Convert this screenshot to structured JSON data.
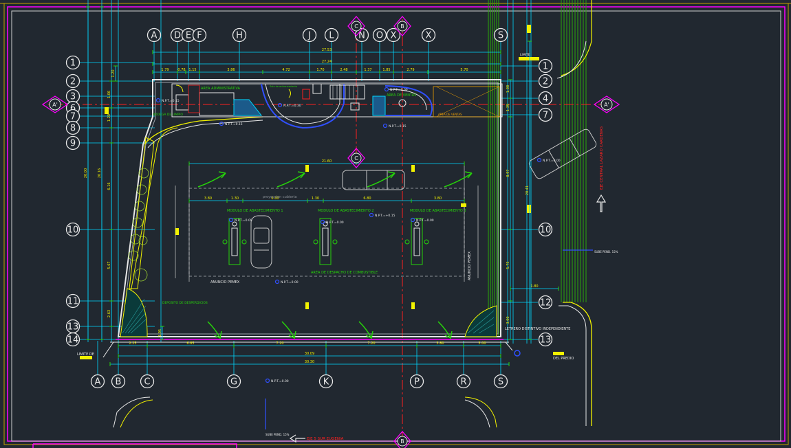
{
  "grid_top": [
    "A",
    "D",
    "E",
    "F",
    "H",
    "J",
    "L",
    "N",
    "O",
    "X",
    "X",
    "S"
  ],
  "grid_bottom": [
    "A",
    "B",
    "C",
    "G",
    "K",
    "P",
    "R",
    "S"
  ],
  "rows_left": [
    "1",
    "2",
    "3",
    "6",
    "7",
    "8",
    "9",
    "10",
    "11",
    "13",
    "14"
  ],
  "rows_right": [
    "1",
    "2",
    "4",
    "7",
    "10",
    "12",
    "13"
  ],
  "section_labels": {
    "a": "A'",
    "c": "C",
    "b": "B"
  },
  "labels": {
    "area_admin": "AREA ADMINISTRATIVA",
    "area_ventas": "AREA DE VENTAS",
    "bodega": "BODEGA DE LIMPIO",
    "sala_entrenamiento": "Sala de entrenamiento",
    "proyeccion_cubierta": "proyeccion cubierta",
    "modulo1": "MODULO DE ABASTECIMIENTO 1",
    "modulo2": "MODULO DE ABASTECIMIENTO 2",
    "modulo3": "MODULO DE ABASTECIMIENTO 3",
    "area_despacho": "AREA DE DESPACHO DE COMBUSTIBLE",
    "anuncio_pemex": "ANUNCIO PEMEX",
    "anuncio_pemex_v": "ANUNCIO PEMEX",
    "deposito": "DEPOSITO DE DESPERDICIOS",
    "letrero": "LETRERO DISTINTIVO INDEPENDIENTE",
    "limite_de": "LIMITE DE",
    "del_predio": "DEL PREDIO",
    "limite": "LIMITE",
    "eje_carretera": "EJE CENTRAL LAZARO CARDENAS",
    "eje_sur": "EJE 5 SUR EUGENIA",
    "sube_pend": "SUBE PEND. 15%",
    "sube_pend2": "SUBE PEND. 15%",
    "npt_main": "N.P.T.=0.00",
    "npt_a": "N.P.T.=0.15",
    "npt_b": "N.P.T.=+0.15",
    "npt_c": "N.P.T.=0.30",
    "npt_d": "N.P.T.=0.15",
    "npt_e": "N.P.T.=0.15",
    "npt_f": "N.P.T.=0.00",
    "npt_g": "N.P.T.=0.00",
    "npt_h": "N.P.T.=0.00",
    "npt_i": "N.P.T.=0.00",
    "npt_j": "N.P.T.=0.00",
    "npt_k": "N.P.T.=0.00",
    "area_vent_small": "AREA DE VENTAS"
  },
  "dims_top": {
    "total1": "27.53",
    "total2": "27.24",
    "segments": [
      "1.79",
      "0.78",
      "1.15",
      "3.86",
      "4.72",
      "1.70",
      "2.48",
      "1.37",
      "1.85",
      "2.79",
      "5.70"
    ]
  },
  "dims_bottom": {
    "segments": [
      "2.25",
      "6.85",
      "7.20",
      "7.20",
      "3.80",
      "3.00"
    ],
    "total1": "30.09",
    "total2": "30.30"
  },
  "dims_canopy": {
    "width": "21.60",
    "left": "3.80",
    "m1": "1.30",
    "m2": "6.80",
    "m3": "1.30",
    "m4": "6.80",
    "right": "3.80"
  },
  "dims_left": [
    "20.00",
    "20.16",
    "1.20",
    "1.06",
    "1.20",
    "6.16",
    "5.67",
    "2.63",
    "1.95"
  ],
  "dims_right": [
    "1.38",
    "1.39",
    "8.97",
    "20.41",
    "5.75",
    "3.00",
    "1.80"
  ],
  "colors": {
    "bg": "#212830",
    "cyan": "#00e5ff",
    "white": "#e8e8e8",
    "green": "#27d40a",
    "yellow": "#f2f200",
    "red": "#ff2020",
    "magenta": "#ff00ff",
    "blue": "#3050ff",
    "gray": "#8a8f96",
    "olive": "#9acd32"
  }
}
